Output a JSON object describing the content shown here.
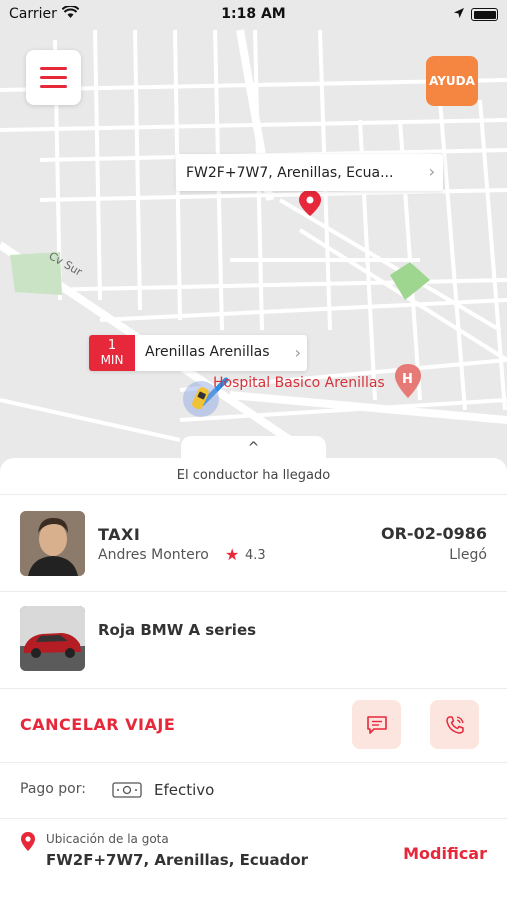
{
  "status_bar": {
    "carrier": "Carrier",
    "time": "1:18 AM"
  },
  "map": {
    "help_button": "AYUDA",
    "destination_label": "FW2F+7W7, Arenillas, Ecua...",
    "origin_eta_number": "1",
    "origin_eta_unit": "MIN",
    "origin_label": "Arenillas Arenillas",
    "road_label": "Cv Sur",
    "poi_label": "Hospital Basico Arenillas"
  },
  "sheet": {
    "status": "El conductor ha llegado",
    "driver": {
      "service": "TAXI",
      "name": "Andres Montero",
      "rating": "4.3",
      "plate": "OR-02-0986",
      "status": "Llegó"
    },
    "car": {
      "model": "Roja BMW A series"
    },
    "actions": {
      "cancel": "CANCELAR VIAJE"
    },
    "payment": {
      "label": "Pago por:",
      "method": "Efectivo"
    },
    "dropoff": {
      "title": "Ubicación de la gota",
      "address": "FW2F+7W7, Arenillas, Ecuador",
      "modify": "Modificar"
    }
  },
  "colors": {
    "accent": "#e6283a",
    "help": "#f58642",
    "map_bg": "#e9e9e9"
  }
}
